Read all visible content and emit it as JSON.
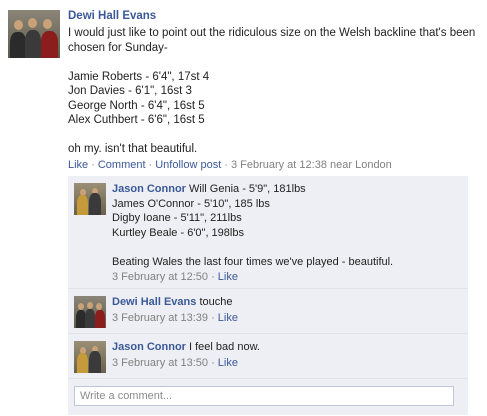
{
  "post": {
    "author": "Dewi Hall Evans",
    "message": "I would just like to point out the ridiculous size on the Welsh backline that's been chosen for Sunday-\n\nJamie Roberts - 6'4\", 17st 4\nJon Davies - 6'1\", 16st 3\nGeorge North - 6'4\", 16st 5\nAlex Cuthbert - 6'6\", 16st 5\n\noh my. isn't that beautiful.",
    "actions": {
      "like": "Like",
      "comment": "Comment",
      "unfollow": "Unfollow post",
      "timestamp": "3 February at 12:38",
      "location": "near London"
    }
  },
  "comments": [
    {
      "author": "Jason Connor",
      "text": "Will Genia - 5'9\", 181lbs\nJames O'Connor - 5'10\", 185 lbs\nDigby Ioane - 5'11\", 211lbs\nKurtley Beale - 6'0\", 198lbs\n\nBeating Wales the last four times we've played - beautiful.",
      "timestamp": "3 February at 12:50",
      "like": "Like"
    },
    {
      "author": "Dewi Hall Evans",
      "text": "touche",
      "timestamp": "3 February at 13:39",
      "like": "Like"
    },
    {
      "author": "Jason Connor",
      "text": "I feel bad now.",
      "timestamp": "3 February at 13:50",
      "like": "Like"
    }
  ],
  "comment_box": {
    "placeholder": "Write a comment..."
  },
  "colors": {
    "link": "#3b5998",
    "meta": "#808080",
    "comment_bg": "#edeff4"
  }
}
